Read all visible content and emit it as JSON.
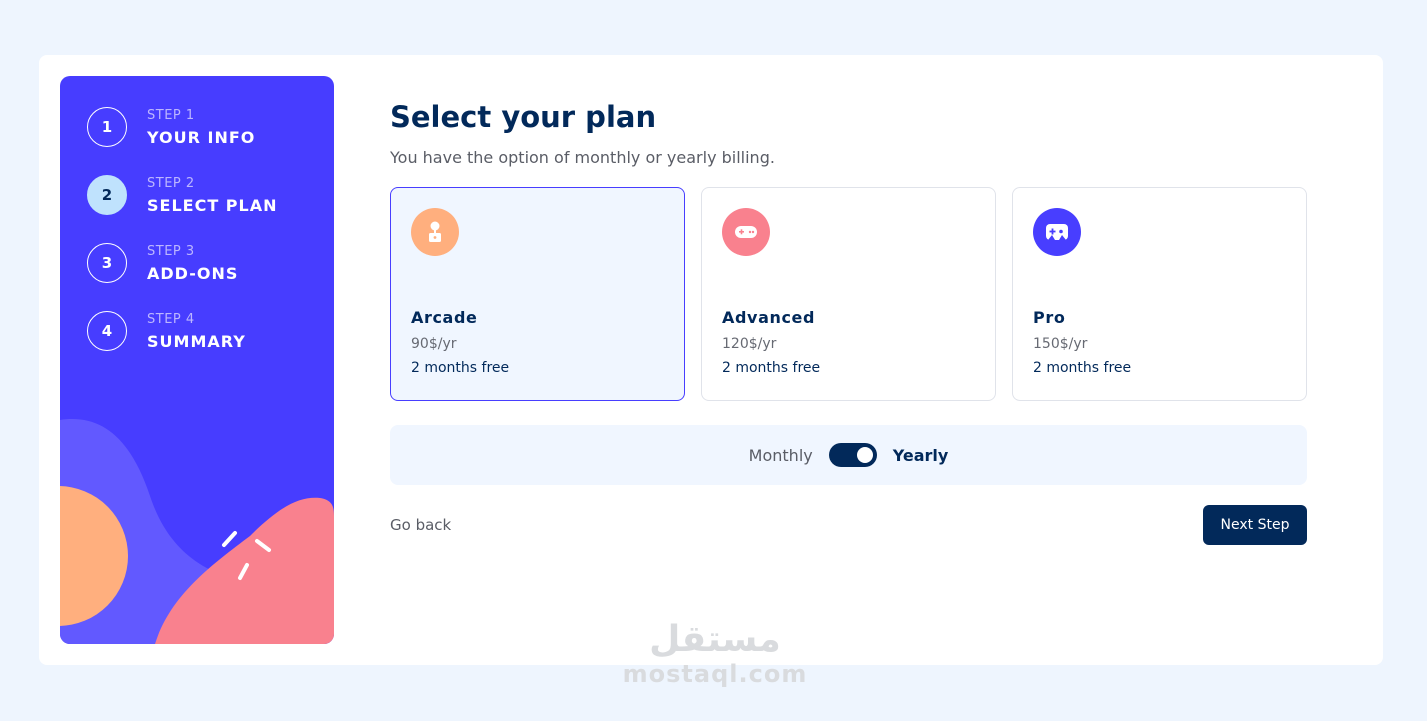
{
  "sidebar": {
    "steps": [
      {
        "number": "1",
        "label": "STEP 1",
        "title": "YOUR INFO",
        "active": false
      },
      {
        "number": "2",
        "label": "STEP 2",
        "title": "SELECT PLAN",
        "active": true
      },
      {
        "number": "3",
        "label": "STEP 3",
        "title": "ADD-ONS",
        "active": false
      },
      {
        "number": "4",
        "label": "STEP 4",
        "title": "SUMMARY",
        "active": false
      }
    ]
  },
  "main": {
    "title": "Select your plan",
    "subtitle": "You have the option of monthly or yearly billing.",
    "plans": [
      {
        "name": "Arcade",
        "price": "90$/yr",
        "free": "2 months free",
        "icon": "joystick-icon",
        "color": "#ffaf7e",
        "selected": true
      },
      {
        "name": "Advanced",
        "price": "120$/yr",
        "free": "2 months free",
        "icon": "gamepad-icon",
        "color": "#f9818e",
        "selected": false
      },
      {
        "name": "Pro",
        "price": "150$/yr",
        "free": "2 months free",
        "icon": "controller-icon",
        "color": "#483eff",
        "selected": false
      }
    ],
    "billing": {
      "monthly": "Monthly",
      "yearly": "Yearly",
      "selected": "Yearly"
    },
    "go_back": "Go back",
    "next_step": "Next Step"
  },
  "watermark": {
    "arabic": "مستقل",
    "latin": "mostaql.com"
  },
  "colors": {
    "page_bg": "#eef5fe",
    "sidebar_bg": "#473dff",
    "marine_blue": "#02295a",
    "purplish_blue": "#483eff",
    "light_blue": "#bfe2fd"
  }
}
